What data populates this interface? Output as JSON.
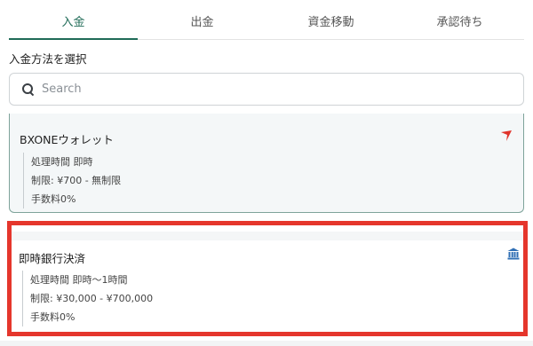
{
  "tabs": [
    {
      "label": "入金",
      "active": true
    },
    {
      "label": "出金",
      "active": false
    },
    {
      "label": "資金移動",
      "active": false
    },
    {
      "label": "承認待ち",
      "active": false
    }
  ],
  "section_label": "入金方法を選択",
  "search": {
    "placeholder": "Search",
    "icon": "search-icon"
  },
  "methods": [
    {
      "name": "BXONEウォレット",
      "icon": "bxone-logo-icon",
      "processing": "処理時間 即時",
      "limit": "制限: ¥700 - 無制限",
      "fee": "手数料0%"
    },
    {
      "name": "即時銀行決済",
      "icon": "bank-icon",
      "processing": "処理時間 即時〜1時間",
      "limit": "制限: ¥30,000 - ¥700,000",
      "fee": "手数料0%",
      "highlighted": true
    }
  ],
  "colors": {
    "accent": "#1f6b57",
    "highlight": "#e5362c",
    "brand_red": "#e0342b",
    "bank_blue": "#2f6fb5"
  }
}
